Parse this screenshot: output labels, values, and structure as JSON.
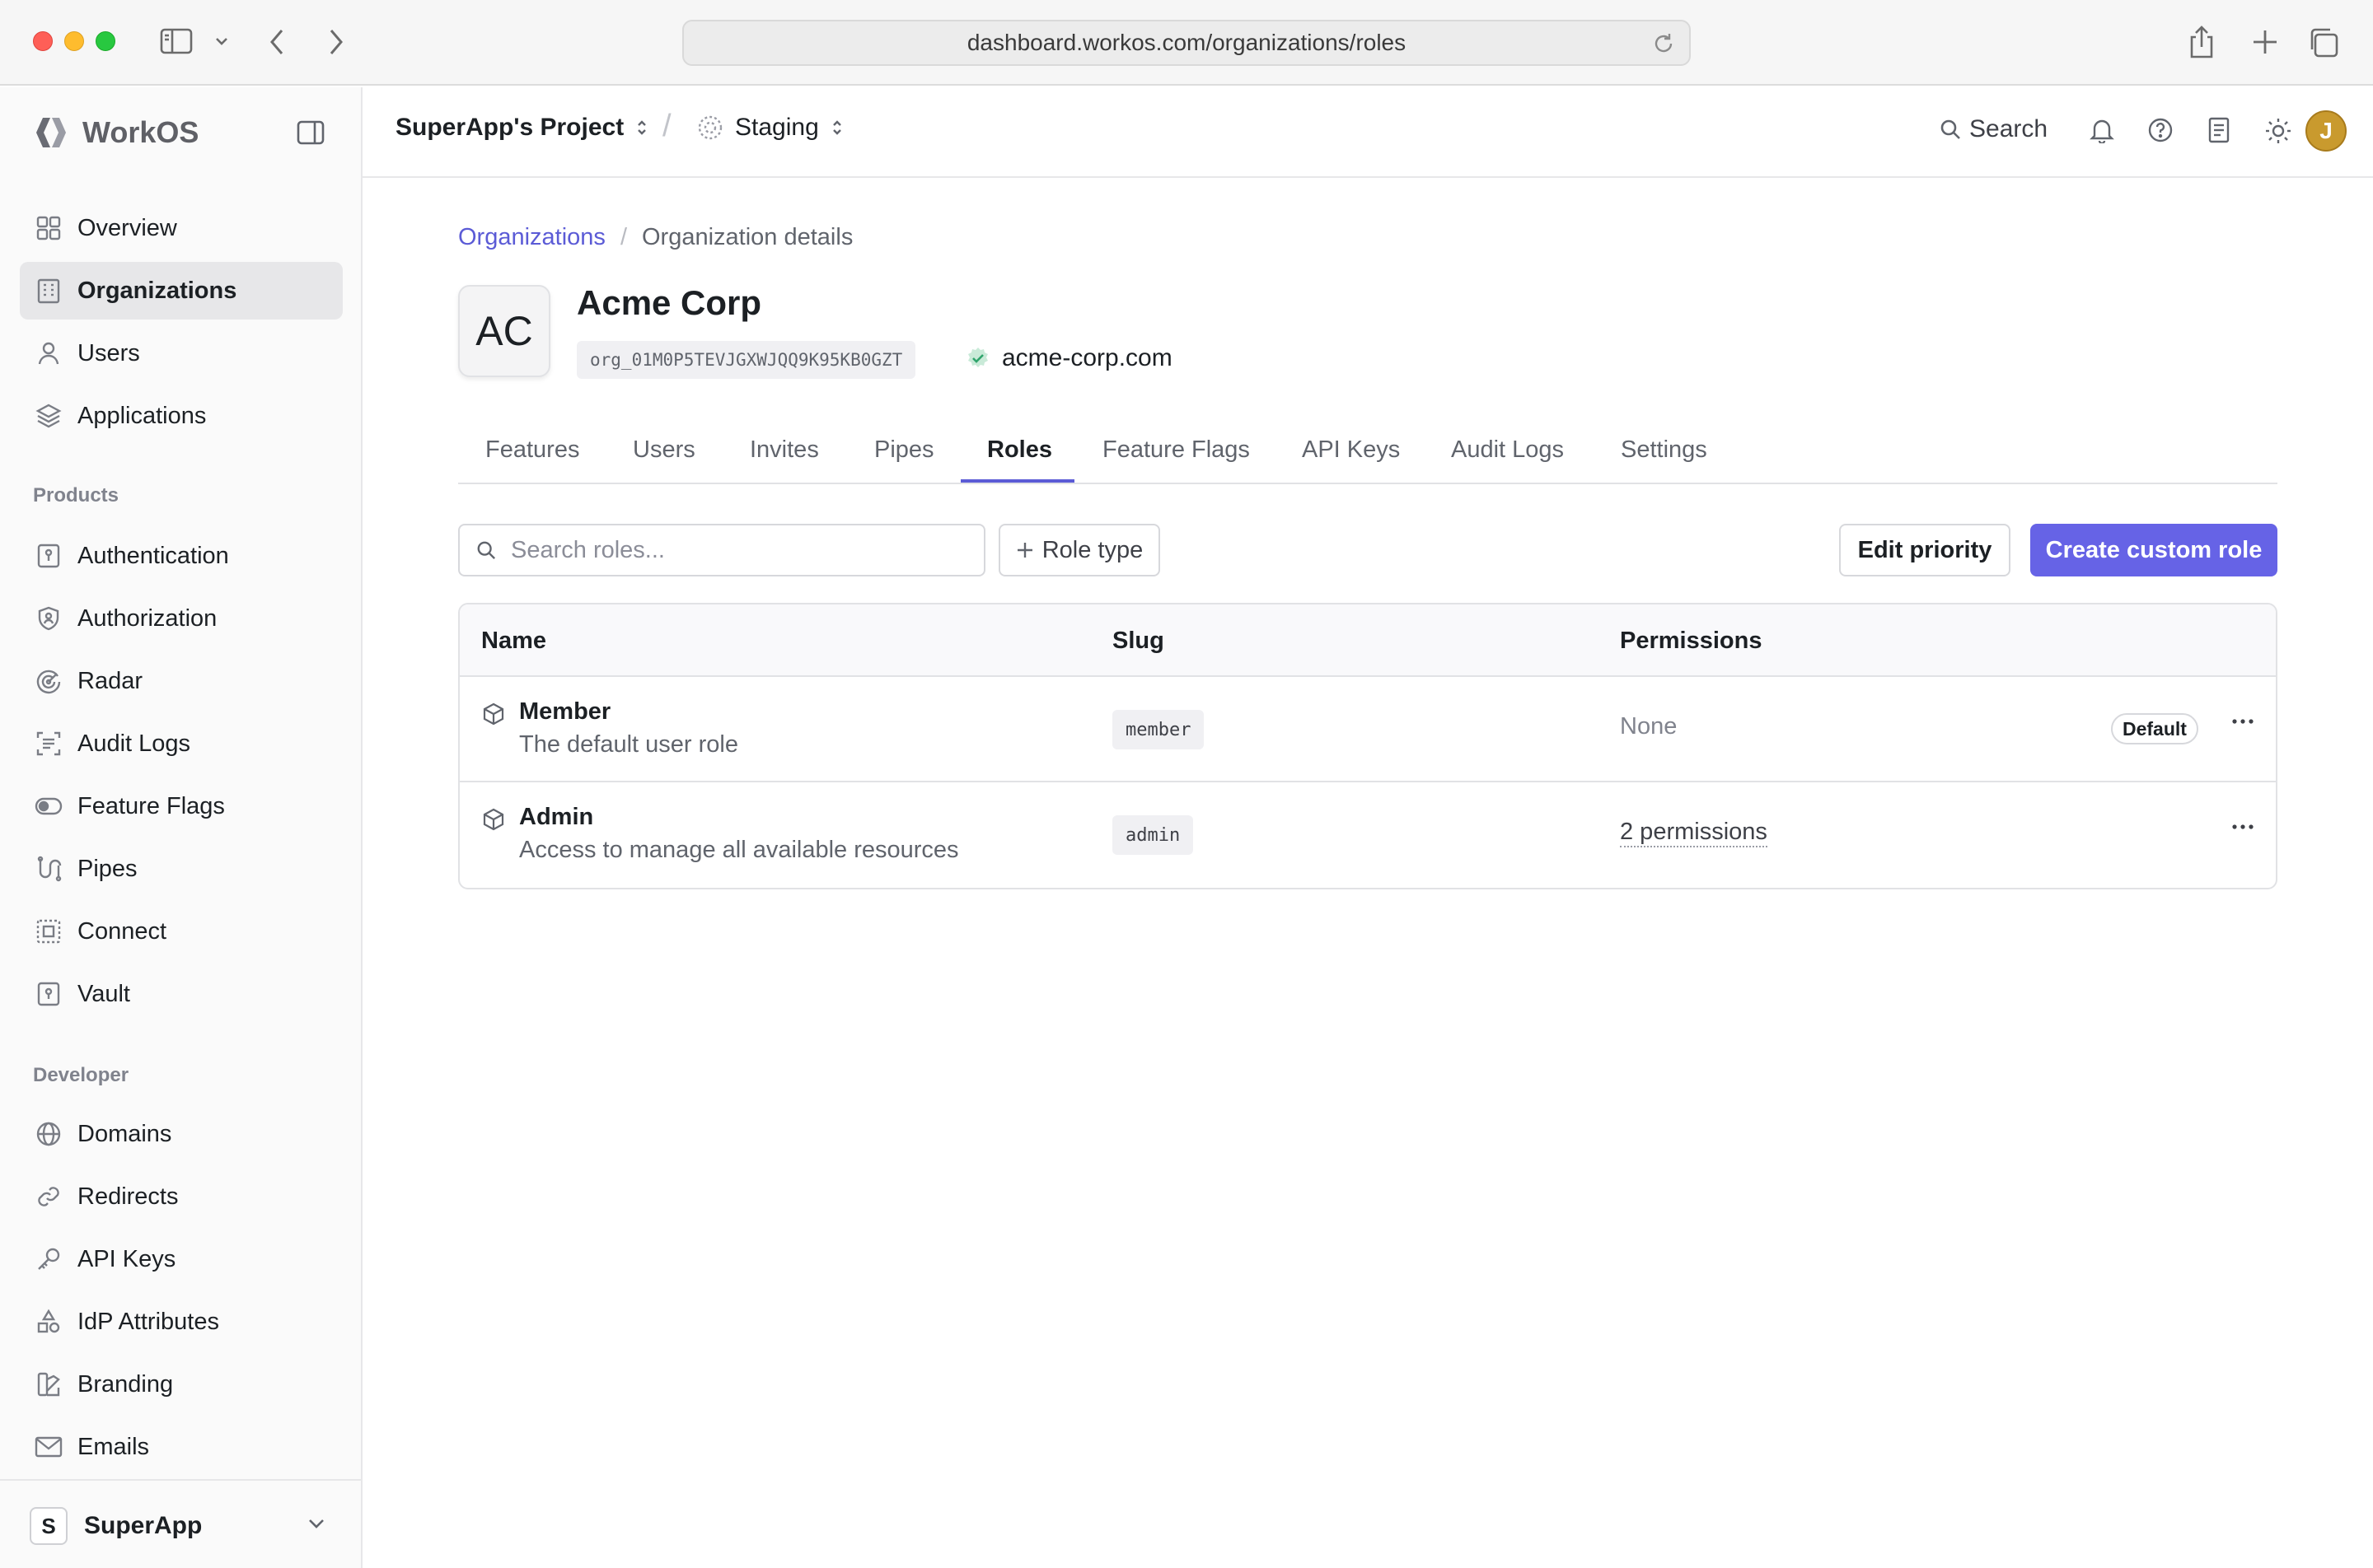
{
  "browser": {
    "url": "dashboard.workos.com/organizations/roles"
  },
  "sidebar": {
    "brand": "WorkOS",
    "main_items": [
      {
        "label": "Overview",
        "icon": "grid-icon"
      },
      {
        "label": "Organizations",
        "icon": "building-icon",
        "active": true
      },
      {
        "label": "Users",
        "icon": "user-icon"
      },
      {
        "label": "Applications",
        "icon": "layers-icon"
      }
    ],
    "products_heading": "Products",
    "product_items": [
      {
        "label": "Authentication",
        "icon": "key-door-icon"
      },
      {
        "label": "Authorization",
        "icon": "shield-user-icon"
      },
      {
        "label": "Radar",
        "icon": "radar-icon"
      },
      {
        "label": "Audit Logs",
        "icon": "audit-scan-icon"
      },
      {
        "label": "Feature Flags",
        "icon": "toggle-icon"
      },
      {
        "label": "Pipes",
        "icon": "pipes-icon"
      },
      {
        "label": "Connect",
        "icon": "connect-icon"
      },
      {
        "label": "Vault",
        "icon": "vault-icon"
      }
    ],
    "developer_heading": "Developer",
    "developer_items": [
      {
        "label": "Domains",
        "icon": "globe-icon"
      },
      {
        "label": "Redirects",
        "icon": "link-icon"
      },
      {
        "label": "API Keys",
        "icon": "key-icon"
      },
      {
        "label": "IdP Attributes",
        "icon": "shapes-icon"
      },
      {
        "label": "Branding",
        "icon": "palette-icon"
      },
      {
        "label": "Emails",
        "icon": "mail-icon"
      }
    ],
    "team": {
      "initial": "S",
      "name": "SuperApp"
    }
  },
  "topbar": {
    "project": "SuperApp's Project",
    "environment": "Staging",
    "search_label": "Search",
    "avatar_initial": "J"
  },
  "breadcrumb": {
    "parent": "Organizations",
    "separator": "/",
    "current": "Organization details"
  },
  "organization": {
    "initials": "AC",
    "name": "Acme Corp",
    "id": "org_01M0P5TEVJGXWJQQ9K95KB0GZT",
    "domain": "acme-corp.com"
  },
  "tabs": [
    "Features",
    "Users",
    "Invites",
    "Pipes",
    "Roles",
    "Feature Flags",
    "API Keys",
    "Audit Logs",
    "Settings"
  ],
  "active_tab": "Roles",
  "toolbar": {
    "search_placeholder": "Search roles...",
    "role_type_label": "Role type",
    "edit_priority_label": "Edit priority",
    "create_label": "Create custom role"
  },
  "table": {
    "headers": {
      "name": "Name",
      "slug": "Slug",
      "permissions": "Permissions"
    },
    "rows": [
      {
        "name": "Member",
        "description": "The default user role",
        "slug": "member",
        "permissions": "None",
        "badge": "Default"
      },
      {
        "name": "Admin",
        "description": "Access to manage all available resources",
        "slug": "admin",
        "permissions": "2 permissions"
      }
    ]
  },
  "colors": {
    "accent": "#6663e6",
    "link": "#5b5bd6",
    "verified": "#30a46c"
  }
}
